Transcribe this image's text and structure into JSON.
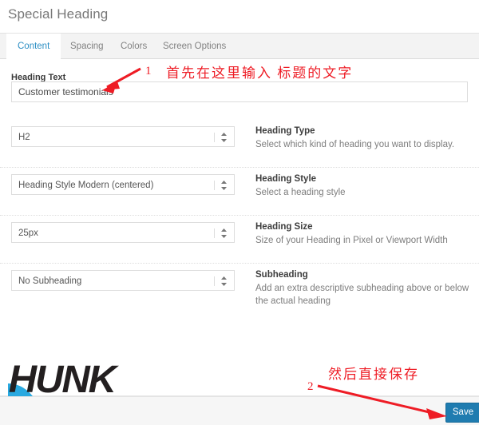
{
  "header": {
    "title": "Special Heading"
  },
  "tabs": [
    {
      "id": "content",
      "label": "Content",
      "active": true
    },
    {
      "id": "spacing",
      "label": "Spacing",
      "active": false
    },
    {
      "id": "colors",
      "label": "Colors",
      "active": false
    },
    {
      "id": "screen_options",
      "label": "Screen Options",
      "active": false
    }
  ],
  "form": {
    "heading_text": {
      "label": "Heading Text",
      "value": "Customer testimonials",
      "placeholder": "Heading Text"
    },
    "rows": [
      {
        "id": "heading_type",
        "select_value": "H2",
        "desc_title": "Heading Type",
        "desc_text": "Select which kind of heading you want to display."
      },
      {
        "id": "heading_style",
        "select_value": "Heading Style Modern (centered)",
        "desc_title": "Heading Style",
        "desc_text": "Select a heading style"
      },
      {
        "id": "heading_size",
        "select_value": "25px",
        "desc_title": "Heading Size",
        "desc_text": "Size of your Heading in Pixel or Viewport Width"
      },
      {
        "id": "subheading",
        "select_value": "No Subheading",
        "desc_title": "Subheading",
        "desc_text": "Add an extra descriptive subheading above or below the actual heading"
      }
    ]
  },
  "footer": {
    "save_label": "Save"
  },
  "logo": {
    "wordmark": "HUNK",
    "url": "www.imhunk.com"
  },
  "annotations": [
    {
      "id": "step-1-number",
      "text": "1"
    },
    {
      "id": "step-1-note",
      "text": "首先在这里输入 标题的文字"
    },
    {
      "id": "step-2-number",
      "text": "2"
    },
    {
      "id": "step-2-note",
      "text": "然后直接保存"
    }
  ],
  "colors": {
    "accent_blue": "#2d8fc4",
    "save_button": "#1f7cb0",
    "annotation_red": "#ee1c25",
    "logo_red": "#e8452c",
    "logo_dark": "#231f20",
    "logo_cyan": "#29a9e0"
  }
}
